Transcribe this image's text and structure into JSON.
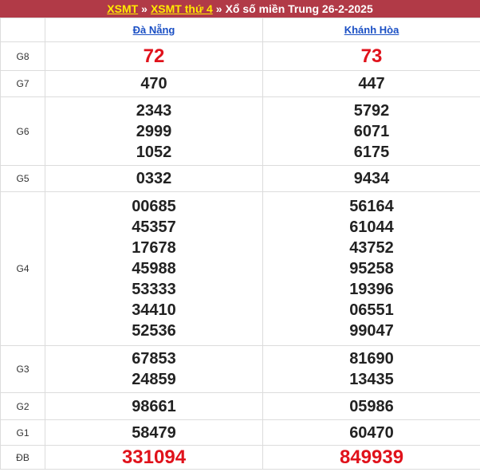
{
  "breadcrumb": {
    "xsmt": "XSMT",
    "xsmt_thu4": "XSMT thứ 4",
    "separator": "»",
    "title": "Xổ số miền Trung 26-2-2025"
  },
  "provinces": [
    "Đà Nẵng",
    "Khánh Hòa"
  ],
  "rows": [
    {
      "label": "G8",
      "values": [
        [
          "72"
        ],
        [
          "73"
        ]
      ]
    },
    {
      "label": "G7",
      "values": [
        [
          "470"
        ],
        [
          "447"
        ]
      ]
    },
    {
      "label": "G6",
      "values": [
        [
          "2343",
          "2999",
          "1052"
        ],
        [
          "5792",
          "6071",
          "6175"
        ]
      ]
    },
    {
      "label": "G5",
      "values": [
        [
          "0332"
        ],
        [
          "9434"
        ]
      ]
    },
    {
      "label": "G4",
      "values": [
        [
          "00685",
          "45357",
          "17678",
          "45988",
          "53333",
          "34410",
          "52536"
        ],
        [
          "56164",
          "61044",
          "43752",
          "95258",
          "19396",
          "06551",
          "99047"
        ]
      ]
    },
    {
      "label": "G3",
      "values": [
        [
          "67853",
          "24859"
        ],
        [
          "81690",
          "13435"
        ]
      ]
    },
    {
      "label": "G2",
      "values": [
        [
          "98661"
        ],
        [
          "05986"
        ]
      ]
    },
    {
      "label": "G1",
      "values": [
        [
          "58479"
        ],
        [
          "60470"
        ]
      ]
    },
    {
      "label": "ĐB",
      "values": [
        [
          "331094"
        ],
        [
          "849939"
        ]
      ]
    }
  ],
  "colors": {
    "header_bg": "#b13a47",
    "breadcrumb_link": "#ffeb00",
    "province_link": "#1a4fc4",
    "highlight_number": "#e0121b"
  }
}
